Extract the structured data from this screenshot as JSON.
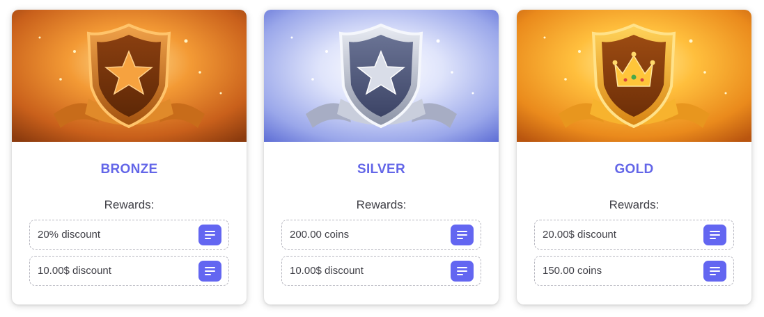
{
  "tiers": [
    {
      "name": "BRONZE",
      "rewards_label": "Rewards:",
      "rewards": [
        "20% discount",
        "10.00$ discount"
      ],
      "emblem": "star-icon",
      "banner_colors": [
        "#f7b03a",
        "#c65a12",
        "#8a3a0c"
      ]
    },
    {
      "name": "SILVER",
      "rewards_label": "Rewards:",
      "rewards": [
        "200.00 coins",
        "10.00$ discount"
      ],
      "emblem": "star-icon",
      "banner_colors": [
        "#ffffff",
        "#b9c3ee",
        "#5e6fd6"
      ]
    },
    {
      "name": "GOLD",
      "rewards_label": "Rewards:",
      "rewards": [
        "20.00$ discount",
        "150.00 coins"
      ],
      "emblem": "crown-icon",
      "banner_colors": [
        "#ffd35a",
        "#f09a1c",
        "#c75c10"
      ]
    }
  ],
  "accent_color": "#6366f1"
}
